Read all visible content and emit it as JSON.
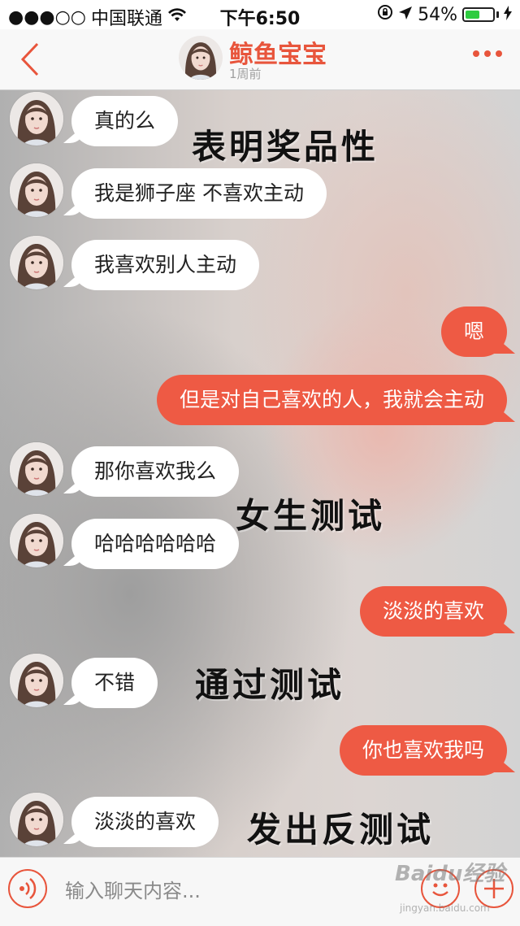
{
  "status_bar": {
    "signal": "●●●○○",
    "carrier": "中国联通",
    "wifi_icon": "wifi-icon",
    "time": "下午6:50",
    "battery_percent": "54%",
    "battery_level": 0.54,
    "accent": "#2ecc40"
  },
  "header": {
    "title": "鲸鱼宝宝",
    "subtitle": "1周前",
    "accent_color": "#e8553c"
  },
  "messages": [
    {
      "side": "in",
      "text": "真的么"
    },
    {
      "side": "in",
      "text": "我是狮子座  不喜欢主动"
    },
    {
      "side": "in",
      "text": "我喜欢别人主动"
    },
    {
      "side": "out",
      "text": "嗯"
    },
    {
      "side": "out",
      "text": "但是对自己喜欢的人，我就会主动"
    },
    {
      "side": "in",
      "text": "那你喜欢我么"
    },
    {
      "side": "in",
      "text": "哈哈哈哈哈哈"
    },
    {
      "side": "out",
      "text": "淡淡的喜欢"
    },
    {
      "side": "in",
      "text": "不错"
    },
    {
      "side": "out",
      "text": "你也喜欢我吗"
    },
    {
      "side": "in",
      "text": "淡淡的喜欢"
    }
  ],
  "overlays": [
    "表明奖品性",
    "女生测试",
    "通过测试",
    "发出反测试"
  ],
  "input_bar": {
    "placeholder": "输入聊天内容..."
  },
  "watermark": {
    "main": "Baidu经验",
    "sub": "jingyan.baidu.com"
  },
  "colors": {
    "bubble_out": "#ee5a44",
    "bubble_in": "#ffffff"
  }
}
